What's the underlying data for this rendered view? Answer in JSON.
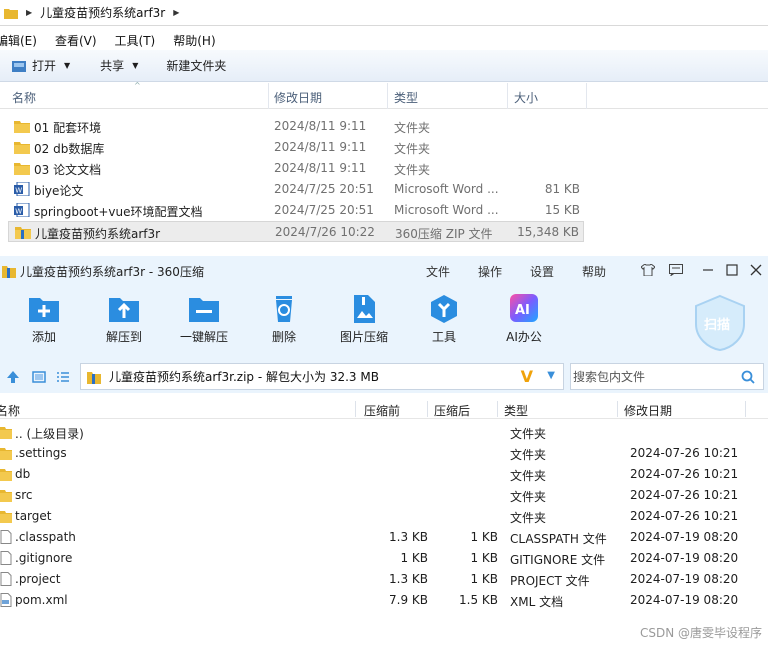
{
  "explorer": {
    "address": {
      "segment": "儿童疫苗预约系统arf3r"
    },
    "menu": [
      "编辑(E)",
      "查看(V)",
      "工具(T)",
      "帮助(H)"
    ],
    "commands": {
      "open": "打开",
      "share": "共享",
      "new_folder": "新建文件夹"
    },
    "columns": {
      "name": "名称",
      "date": "修改日期",
      "type": "类型",
      "size": "大小"
    },
    "files": [
      {
        "name": "01 配套环境",
        "date": "2024/8/11 9:11",
        "type": "文件夹",
        "size": "",
        "icon": "folder-icon"
      },
      {
        "name": "02 db数据库",
        "date": "2024/8/11 9:11",
        "type": "文件夹",
        "size": "",
        "icon": "folder-icon"
      },
      {
        "name": "03 论文文档",
        "date": "2024/8/11 9:11",
        "type": "文件夹",
        "size": "",
        "icon": "folder-icon"
      },
      {
        "name": "biye论文",
        "date": "2024/7/25 20:51",
        "type": "Microsoft Word ...",
        "size": "81 KB",
        "icon": "word-doc-icon"
      },
      {
        "name": "springboot+vue环境配置文档",
        "date": "2024/7/25 20:51",
        "type": "Microsoft Word ...",
        "size": "15 KB",
        "icon": "word-doc-icon"
      },
      {
        "name": "儿童疫苗预约系统arf3r",
        "date": "2024/7/26 10:22",
        "type": "360压缩 ZIP 文件",
        "size": "15,348 KB",
        "icon": "zip-archive-icon",
        "selected": true
      }
    ]
  },
  "zip_window": {
    "title": "儿童疫苗预约系统arf3r - 360压缩",
    "menu": [
      "文件",
      "操作",
      "设置",
      "帮助"
    ],
    "tools": [
      "添加",
      "解压到",
      "一键解压",
      "删除",
      "图片压缩",
      "工具",
      "AI办公"
    ],
    "ai_badge": "AI",
    "scan_label": "扫描",
    "path_text": "儿童疫苗预约系统arf3r.zip - 解包大小为 32.3 MB",
    "search_placeholder": "搜索包内文件",
    "columns": {
      "name": "名称",
      "compressed": "压缩前",
      "packed": "压缩后",
      "type": "类型",
      "date": "修改日期"
    },
    "entries": [
      {
        "name": ".. (上级目录)",
        "compressed": "",
        "packed": "",
        "type": "文件夹",
        "date": "",
        "icon": "folder-icon"
      },
      {
        "name": ".settings",
        "compressed": "",
        "packed": "",
        "type": "文件夹",
        "date": "2024-07-26 10:21",
        "icon": "folder-icon"
      },
      {
        "name": "db",
        "compressed": "",
        "packed": "",
        "type": "文件夹",
        "date": "2024-07-26 10:21",
        "icon": "folder-icon"
      },
      {
        "name": "src",
        "compressed": "",
        "packed": "",
        "type": "文件夹",
        "date": "2024-07-26 10:21",
        "icon": "folder-icon"
      },
      {
        "name": "target",
        "compressed": "",
        "packed": "",
        "type": "文件夹",
        "date": "2024-07-26 10:21",
        "icon": "folder-icon"
      },
      {
        "name": ".classpath",
        "compressed": "1.3 KB",
        "packed": "1 KB",
        "type": "CLASSPATH 文件",
        "date": "2024-07-19 08:20",
        "icon": "file-icon"
      },
      {
        "name": ".gitignore",
        "compressed": "1 KB",
        "packed": "1 KB",
        "type": "GITIGNORE 文件",
        "date": "2024-07-19 08:20",
        "icon": "file-icon"
      },
      {
        "name": ".project",
        "compressed": "1.3 KB",
        "packed": "1 KB",
        "type": "PROJECT 文件",
        "date": "2024-07-19 08:20",
        "icon": "file-icon"
      },
      {
        "name": "pom.xml",
        "compressed": "7.9 KB",
        "packed": "1.5 KB",
        "type": "XML 文档",
        "date": "2024-07-19 08:20",
        "icon": "xml-file-icon"
      }
    ]
  },
  "watermark": "CSDN @唐雯毕设程序",
  "colors": {
    "folder": "#e8b730",
    "accent_blue": "#2b8de0",
    "toolbar_bg": "#eaf4fd"
  }
}
